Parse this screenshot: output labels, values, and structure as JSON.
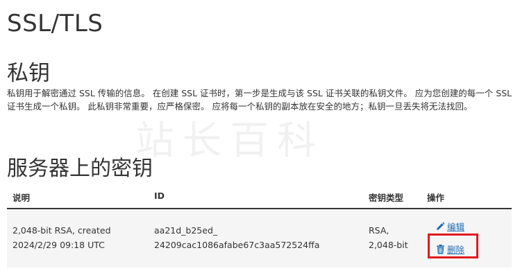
{
  "page_title": "SSL/TLS",
  "section": {
    "title": "私钥",
    "description": "私钥用于解密通过 SSL 传输的信息。 在创建 SSL 证书时，第一步是生成与该 SSL 证书关联的私钥文件。 应为您创建的每一个 SSL 证书生成一个私钥。 此私钥非常重要，应严格保密。 应将每一个私钥的副本放在安全的地方；私钥一旦丢失将无法找回。"
  },
  "watermark": "站长百科",
  "keys_section": {
    "title": "服务器上的密钥",
    "columns": [
      "说明",
      "ID",
      "密钥类型",
      "操作"
    ],
    "rows": [
      {
        "description_line1": "2,048-bit RSA, created",
        "description_line2": "2024/2/29 09:18 UTC",
        "id_line1": "aa21d_b25ed_",
        "id_line2": "24209cac1086afabe67c3aa572524ffa",
        "type_line1": "RSA,",
        "type_line2": "2,048-bit",
        "edit_label": "编辑",
        "delete_label": "删除",
        "edit_icon": "pencil-icon",
        "delete_icon": "trash-icon"
      }
    ]
  },
  "colors": {
    "link": "#1f6fb2",
    "highlight": "#e0191e",
    "row_background": "#f5f5f5"
  }
}
